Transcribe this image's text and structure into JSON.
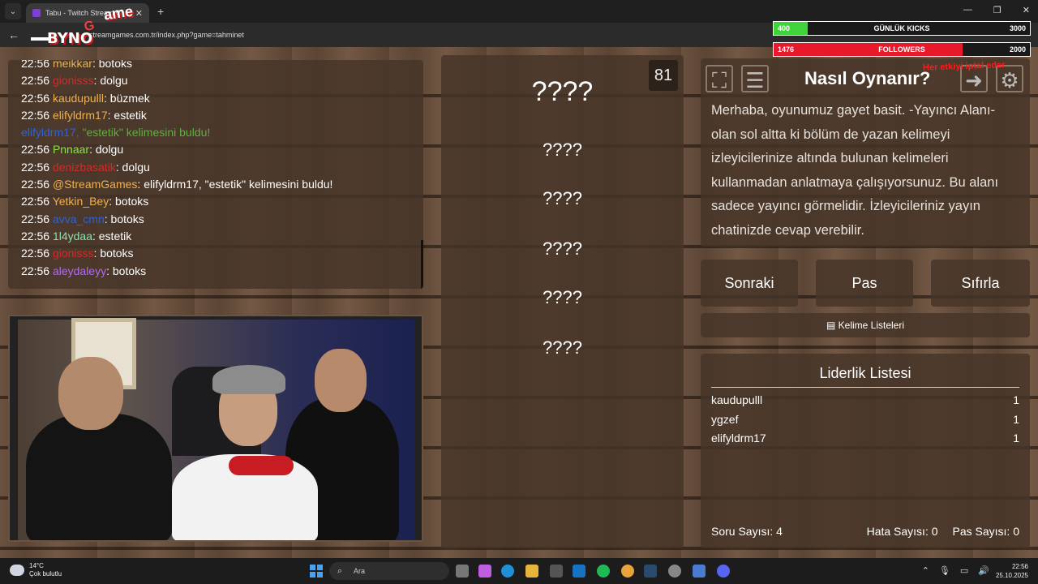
{
  "browser": {
    "tab_title": "Tabu - Twitch Stream G",
    "url": "streamgames.com.tr/index.php?game=tahminet"
  },
  "overlay": {
    "logo_text": [
      "BYNO",
      "G",
      "ame"
    ],
    "kicks_bar": {
      "label": "GÜNLÜK KICKS",
      "left": "400",
      "right": "3000",
      "progress": 0.133,
      "color": "#3fd43a"
    },
    "followers_bar": {
      "label": "FOLLOWERS",
      "left": "1476",
      "right": "2000",
      "progress": 0.738,
      "color": "#e8192a"
    },
    "red_note": "Her etkiyi iptal eder"
  },
  "chat": {
    "messages": [
      {
        "time": "22:56",
        "user": "meikkar",
        "text": "botoks",
        "color": "#e3b45c"
      },
      {
        "time": "22:56",
        "user": "gionisss",
        "text": "dolgu",
        "color": "#d42a2a"
      },
      {
        "time": "22:56",
        "user": "kaudupulll",
        "text": "büzmek",
        "color": "#f0b04a"
      },
      {
        "time": "22:56",
        "user": "elifyldrm17",
        "text": "estetik",
        "color": "#f0b04a"
      },
      {
        "time": "",
        "user": "elifyldrm17,",
        "text": "\"estetik\" kelimesini buldu!",
        "color": "#2f62d8",
        "system": true
      },
      {
        "time": "22:56",
        "user": "Pnnaar",
        "text": "dolgu",
        "color": "#8be04a"
      },
      {
        "time": "22:56",
        "user": "denizbasatik",
        "text": "dolgu",
        "color": "#d42a2a"
      },
      {
        "time": "22:56",
        "user": "@StreamGames",
        "text": "elifyldrm17, \"estetik\" kelimesini buldu!",
        "color": "#f0b04a"
      },
      {
        "time": "22:56",
        "user": "Yetkin_Bey",
        "text": "botoks",
        "color": "#f0b04a"
      },
      {
        "time": "22:56",
        "user": "avva_cmn",
        "text": "botoks",
        "color": "#2f62d8"
      },
      {
        "time": "22:56",
        "user": "1l4ydaa",
        "text": "estetik",
        "color": "#8be0b0"
      },
      {
        "time": "22:56",
        "user": "gionisss",
        "text": "botoks",
        "color": "#d42a2a"
      },
      {
        "time": "22:56",
        "user": "aleydaleyy",
        "text": "botoks",
        "color": "#b26bf0"
      }
    ]
  },
  "game": {
    "timer": "81",
    "main_word": "????",
    "forbidden_words": [
      "????",
      "????",
      "????",
      "????",
      "????"
    ]
  },
  "info": {
    "title": "Nasıl Oynanır?",
    "text": "Merhaba, oyunumuz gayet basit. -Yayıncı Alanı- olan sol altta ki bölüm de yazan kelimeyi izleyicilerinize altında bulunan kelimeleri kullanmadan anlatmaya çalışıyorsunuz. Bu alanı sadece yayıncı görmelidir. İzleyicileriniz yayın chatinizde cevap verebilir."
  },
  "buttons": {
    "next": "Sonraki",
    "pass": "Pas",
    "reset": "Sıfırla",
    "word_lists": "Kelime Listeleri"
  },
  "leaderboard": {
    "title": "Liderlik Listesi",
    "rows": [
      {
        "name": "kaudupulll",
        "score": "1"
      },
      {
        "name": "ygzef",
        "score": "1"
      },
      {
        "name": "elifyldrm17",
        "score": "1"
      }
    ],
    "question_count": "Soru Sayısı: 4",
    "error_count": "Hata Sayısı: 0",
    "pass_count": "Pas Sayısı: 0"
  },
  "taskbar": {
    "weather_temp": "14°C",
    "weather_desc": "Çok bulutlu",
    "search_placeholder": "Ara",
    "time": "22:56",
    "date": "25.10.2025"
  }
}
